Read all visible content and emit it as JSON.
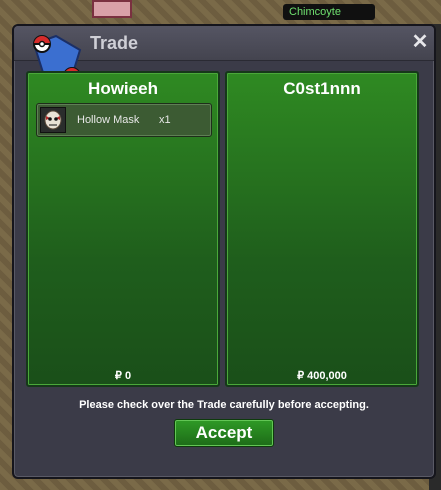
{
  "window": {
    "title": "Trade"
  },
  "world": {
    "chat_tag": "Chimcoyte"
  },
  "left_panel": {
    "player": "Howieeh",
    "items": [
      {
        "name": "Hollow Mask",
        "qty": "x1",
        "icon": "hollow-mask-icon"
      }
    ],
    "money": "₽ 0"
  },
  "right_panel": {
    "player": "C0st1nnn",
    "items": [],
    "money": "₽ 400,000"
  },
  "notice": "Please check over the Trade carefully before accepting.",
  "accept_label": "Accept",
  "colors": {
    "panel_green": "#2f8a22",
    "window_bg": "#3b3b48",
    "accept_green": "#2f9a26"
  }
}
